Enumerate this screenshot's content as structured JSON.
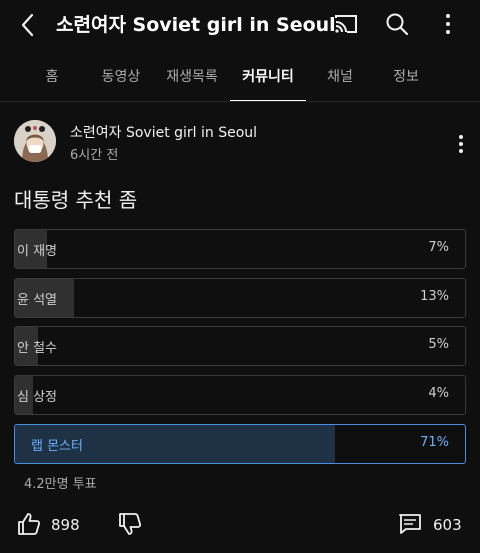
{
  "header": {
    "title": "소련여자 Soviet girl in Seoul",
    "icons": [
      "back-icon",
      "cast-icon",
      "search-icon",
      "more-vert-icon"
    ]
  },
  "tabs": [
    {
      "label": "홈",
      "active": false
    },
    {
      "label": "동영상",
      "active": false
    },
    {
      "label": "재생목록",
      "active": false
    },
    {
      "label": "커뮤니티",
      "active": true
    },
    {
      "label": "채널",
      "active": false
    },
    {
      "label": "정보",
      "active": false
    }
  ],
  "post": {
    "author": "소련여자 Soviet girl in Seoul",
    "time": "6시간 전",
    "question": "대통령 추천 좀"
  },
  "poll": {
    "options": [
      {
        "label": "이 재명",
        "percent": "7%",
        "fraction": 0.07,
        "selected": false
      },
      {
        "label": "윤 석열",
        "percent": "13%",
        "fraction": 0.13,
        "selected": false
      },
      {
        "label": "안 철수",
        "percent": "5%",
        "fraction": 0.05,
        "selected": false
      },
      {
        "label": "심 상정",
        "percent": "4%",
        "fraction": 0.04,
        "selected": false
      },
      {
        "label": "랩 몬스터",
        "percent": "71%",
        "fraction": 0.71,
        "selected": true
      }
    ],
    "votes": "4.2만명 투표"
  },
  "actions": {
    "likes": "898",
    "comments": "603"
  },
  "colors": {
    "background": "#0f0f0f",
    "option_border": "#3a3a3a",
    "option_fill": "#303030",
    "selected_accent": "#6ab0ff",
    "selected_fill": "#1f3245"
  }
}
